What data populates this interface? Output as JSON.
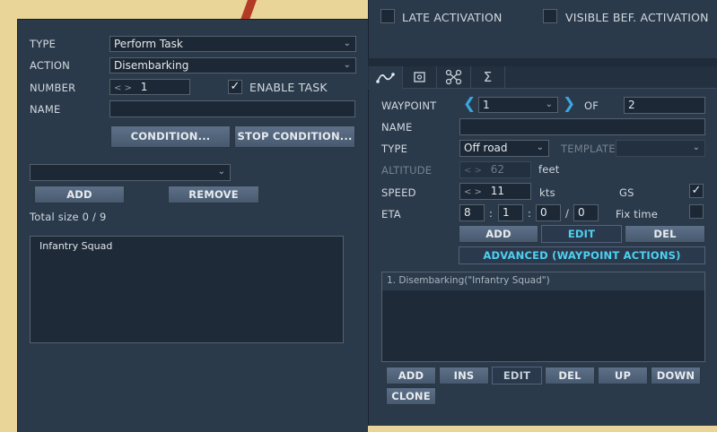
{
  "left": {
    "type_label": "TYPE",
    "type_value": "Perform Task",
    "action_label": "ACTION",
    "action_value": "Disembarking",
    "number_label": "NUMBER",
    "number_arrows": "< >",
    "number_value": "1",
    "enable_task_label": "ENABLE TASK",
    "name_label": "NAME",
    "name_value": "",
    "condition_btn": "CONDITION...",
    "stop_condition_btn": "STOP CONDITION...",
    "select_value": "",
    "add_btn": "ADD",
    "remove_btn": "REMOVE",
    "total_size": "Total size 0 / 9",
    "list_items": [
      "Infantry Squad"
    ]
  },
  "right": {
    "late_activation_label": "LATE ACTIVATION",
    "visible_bef_label": "VISIBLE BEF. ACTIVATION",
    "tabs": [
      "route-icon",
      "target-icon",
      "network-icon",
      "sigma-icon"
    ],
    "waypoint_label": "WAYPOINT",
    "waypoint_value": "1",
    "of_label": "OF",
    "of_value": "2",
    "name_label": "NAME",
    "name_value": "",
    "type_label": "TYPE",
    "type_value": "Off road",
    "template_label": "TEMPLATE",
    "template_value": "",
    "altitude_label": "ALTITUDE",
    "altitude_arrows": "< >",
    "altitude_value": "62",
    "altitude_unit": "feet",
    "speed_label": "SPEED",
    "speed_arrows": "< >",
    "speed_value": "11",
    "speed_unit": "kts",
    "gs_label": "GS",
    "eta_label": "ETA",
    "eta_d": "8",
    "eta_h": "1",
    "eta_m": "0",
    "eta_s": "0",
    "eta_sep1": ":",
    "eta_sep2": ":",
    "eta_sep3": "/",
    "fix_time_label": "Fix time",
    "add_btn": "ADD",
    "edit_btn": "EDIT",
    "del_btn": "DEL",
    "advanced_btn": "ADVANCED (WAYPOINT ACTIONS)",
    "actions_list": [
      "1. Disembarking(\"Infantry Squad\")"
    ],
    "bottom_buttons": {
      "add": "ADD",
      "ins": "INS",
      "edit": "EDIT",
      "del": "DEL",
      "up": "UP",
      "down": "DOWN",
      "clone": "CLONE"
    }
  },
  "colors": {
    "map_background": "#e8d597",
    "panel": "#2b3a4b",
    "accent_cyan": "#4fd0f2",
    "button": "#55687f"
  }
}
